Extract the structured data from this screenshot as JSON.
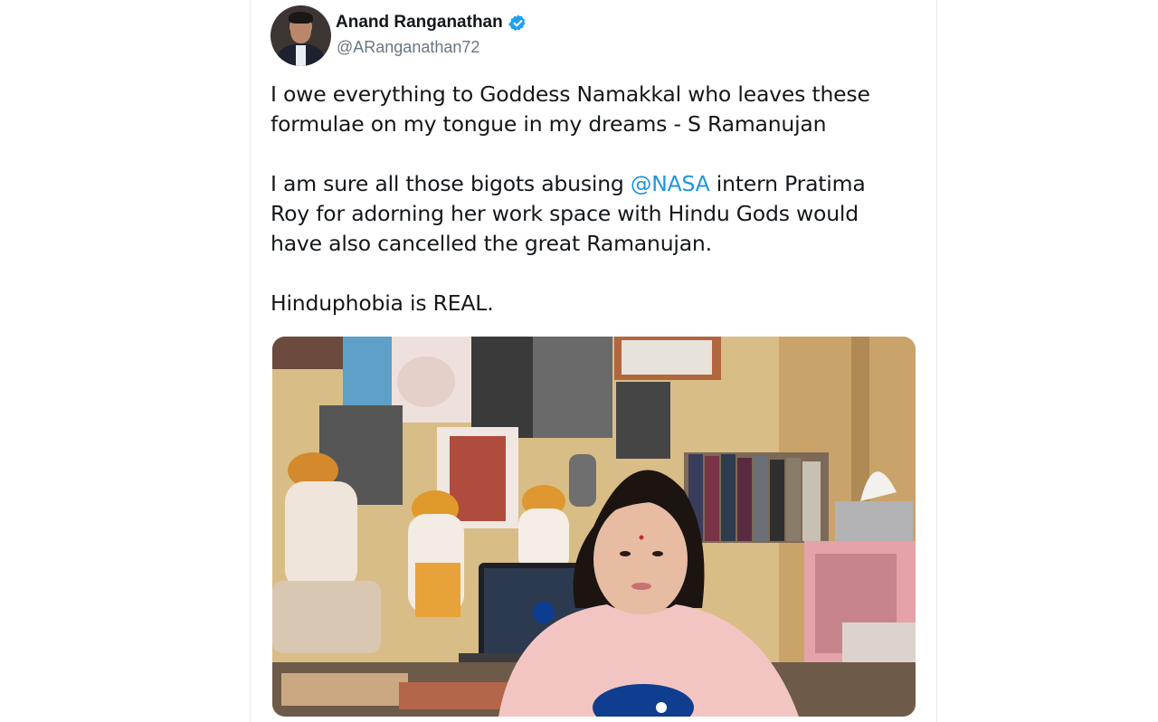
{
  "author": {
    "display_name": "Anand Ranganathan",
    "handle": "@ARanganathan72",
    "verified": true
  },
  "tweet": {
    "paragraph1_line1": "I owe everything to Goddess Namakkal who leaves these",
    "paragraph1_line2": "formulae on my tongue in my dreams - S Ramanujan",
    "paragraph2_before": "I am sure all those bigots abusing ",
    "paragraph2_mention": "@NASA",
    "paragraph2_after_line1": " intern Pratima",
    "paragraph2_line2": "Roy for adorning her work space with Hindu Gods would",
    "paragraph2_line3": "have also cancelled the great Ramanujan.",
    "paragraph3": "Hinduphobia is REAL."
  },
  "icons": {
    "verified": "verified-badge-icon"
  },
  "colors": {
    "text": "#14171a",
    "secondary_text": "#657786",
    "link": "#1b95e0",
    "verified": "#1da1f2"
  }
}
